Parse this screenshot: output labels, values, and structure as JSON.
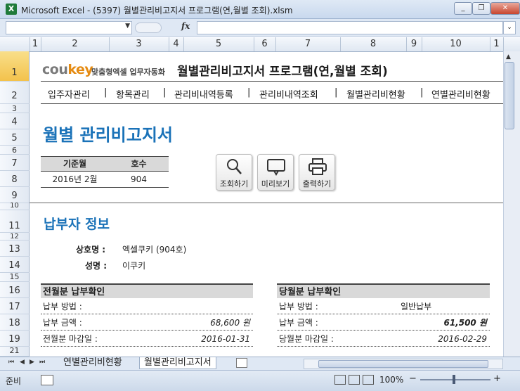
{
  "window": {
    "title": "Microsoft Excel - (5397) 월별관리비고지서 프로그램(연,월별 조회).xlsm",
    "app_icon": "X",
    "min": "▭",
    "max": "❐",
    "close": "✕"
  },
  "formula_bar": {
    "fx": "fx",
    "namebox_arrow": "▼",
    "expand": "⌄"
  },
  "columns": [
    "1",
    "2",
    "3",
    "4",
    "5",
    "6",
    "7",
    "8",
    "9",
    "10",
    "1"
  ],
  "rows": [
    "1",
    "2",
    "3",
    "4",
    "5",
    "6",
    "7",
    "8",
    "9",
    "10",
    "11",
    "12",
    "13",
    "14",
    "15",
    "16",
    "17",
    "18",
    "19",
    "21"
  ],
  "header": {
    "logo_a": "cou",
    "logo_b": "key",
    "tagline": "맞춤형엑셀 업무자동화",
    "app_title": "월별관리비고지서 프로그램(연,월별 조회)"
  },
  "nav": [
    "입주자관리",
    "항목관리",
    "관리비내역등록",
    "관리비내역조회",
    "월별관리비현황",
    "연별관리비현황"
  ],
  "nav_sep": "|",
  "page_title": "월별 관리비고지서",
  "criteria": {
    "month_label": "기준월",
    "unit_label": "호수",
    "month_value": "2016년 2월",
    "unit_value": "904"
  },
  "actions": [
    {
      "label": "조회하기",
      "icon": "search-icon"
    },
    {
      "label": "미리보기",
      "icon": "preview-icon"
    },
    {
      "label": "출력하기",
      "icon": "print-icon"
    }
  ],
  "payer": {
    "title": "납부자 정보",
    "company_label": "상호명 :",
    "company_value": "엑셀쿠키 (904호)",
    "name_label": "성명 :",
    "name_value": "이쿠키"
  },
  "prev": {
    "title": "전월분 납부확인",
    "method_label": "납부 방법 :",
    "method_value": "",
    "amount_label": "납부 금액 :",
    "amount_value": "68,600 원",
    "due_label": "전월분 마감일 :",
    "due_value": "2016-01-31"
  },
  "curr": {
    "title": "당월분 납부확인",
    "method_label": "납부 방법 :",
    "method_value": "일반납부",
    "amount_label": "납부 금액 :",
    "amount_value": "61,500 원",
    "due_label": "당월분 마감일 :",
    "due_value": "2016-02-29"
  },
  "sheet_tabs": [
    "연별관리비현황",
    "월별관리비고지서"
  ],
  "tab_nav": [
    "⏮",
    "◀",
    "▶",
    "⏭"
  ],
  "status": {
    "ready": "준비",
    "zoom": "100%",
    "minus": "−",
    "plus": "+"
  }
}
